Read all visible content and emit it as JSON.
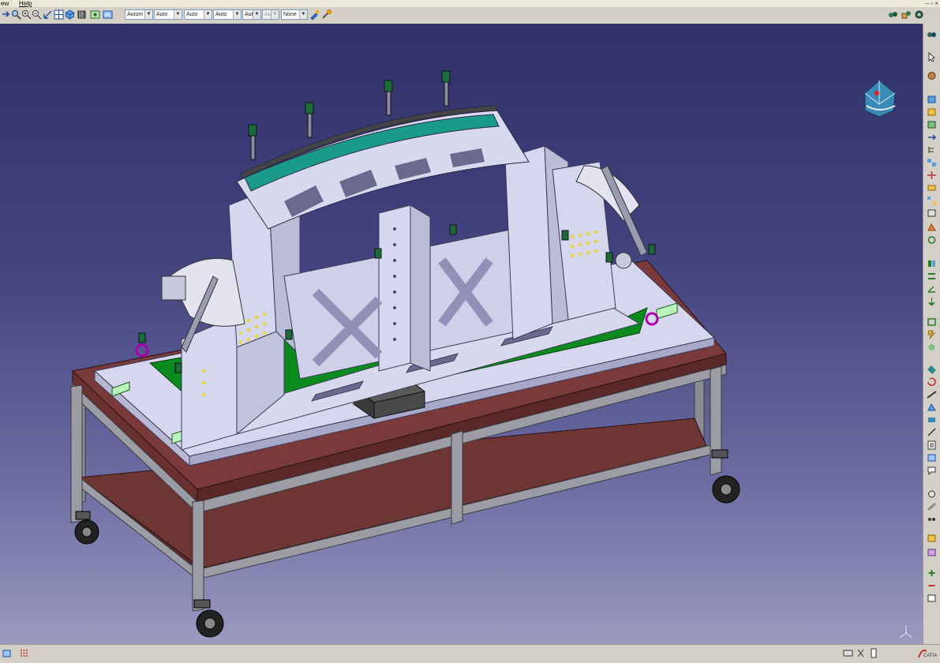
{
  "menubar": {
    "items": [
      {
        "label": "ew"
      },
      {
        "label": "Help"
      }
    ]
  },
  "toolbar": {
    "combos": [
      {
        "value": "Autom"
      },
      {
        "value": "Auto"
      },
      {
        "value": "Auto"
      },
      {
        "value": "Auto"
      },
      {
        "value": "Aut"
      },
      {
        "value": "Aut"
      },
      {
        "value": "None"
      }
    ]
  },
  "status": {
    "brand": "CATIA"
  },
  "colors": {
    "viewport_top": "#30306a",
    "viewport_bottom": "#9a9ac0",
    "fixture_steel": "#d6d6ee",
    "board_green": "#0b8a1e",
    "table_top": "#7a3a3a",
    "clamp_green": "#1c6a3a"
  }
}
